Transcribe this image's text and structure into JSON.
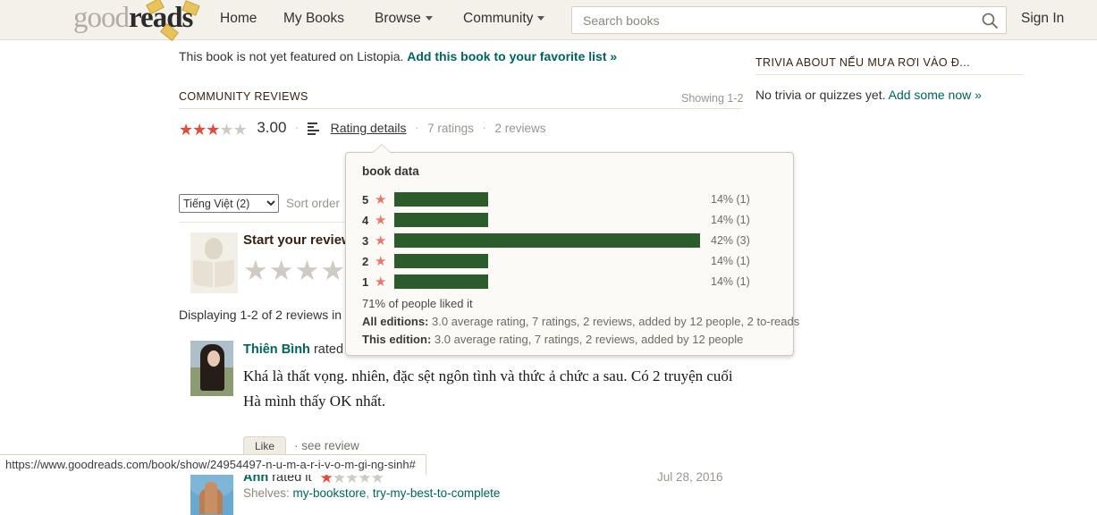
{
  "header": {
    "logo_good": "good",
    "logo_reads": "reads",
    "nav": [
      {
        "label": "Home"
      },
      {
        "label": "My Books"
      },
      {
        "label": "Browse"
      },
      {
        "label": "Community"
      }
    ],
    "search_placeholder": "Search books",
    "search_value": "",
    "search_icon": "search-icon",
    "sign_in": "Sign In"
  },
  "main": {
    "listopia_text": "This book is not yet featured on Listopia.",
    "listopia_link": "Add this book to your favorite list »",
    "community_reviews_heading": "COMMUNITY REVIEWS",
    "showing": "Showing 1-2",
    "rating": {
      "average": "3.00",
      "filled_stars": 3,
      "total_stars": 5,
      "rating_details_label": "Rating details",
      "rating_details_icon": "bar-chart-icon",
      "ratings_count": "7 ratings",
      "reviews_count": "2 reviews",
      "separator": "·"
    },
    "language_filter": {
      "selected": "Tiếng Việt (2)",
      "options": [
        "Tiếng Việt (2)"
      ]
    },
    "sort_order_label": "Sort order",
    "start_your_review": {
      "title": "Start your review",
      "stars": 5,
      "avatar_icon": "default-reader-avatar"
    },
    "displaying_text": "Displaying 1-2 of 2 reviews in",
    "reviews": [
      {
        "name": "Thiên Bình",
        "action": "rated it",
        "body": "Khá là thất vọng. nhiên, đặc sệt ngôn tình và thức ả chức a sau. Có 2 truyện cuối Hà mình thấy OK nhất.",
        "like_label": "Like",
        "see_review_label": "· see review",
        "avatar_icon": "user-photo-avatar"
      },
      {
        "name": "Anh",
        "action": "rated it",
        "filled_stars": 1,
        "total_stars": 5,
        "date": "Jul 28, 2016",
        "shelves_label": "Shelves:",
        "shelves": [
          "my-bookstore",
          "try-my-best-to-complete"
        ],
        "avatar_icon": "user-photo-avatar"
      }
    ]
  },
  "sidebar": {
    "trivia_heading": "TRIVIA ABOUT NẾU MƯA RƠI VÀO Đ...",
    "trivia_empty": "No trivia or quizzes yet.",
    "trivia_link": "Add some now »"
  },
  "tooltip": {
    "title": "book data",
    "liked_text": "71% of people liked it",
    "all_editions_label": "All editions:",
    "all_editions_text": "3.0 average rating, 7 ratings, 2 reviews, added by 12 people, 2 to-reads",
    "this_edition_label": "This edition:",
    "this_edition_text": "3.0 average rating, 7 ratings, 2 reviews, added by 12 people"
  },
  "status_bar": {
    "url": "https://www.goodreads.com/book/show/24954497-n-u-m-a-r-i-v-o-m-gi-ng-sinh#"
  },
  "colors": {
    "header_bg": "#f4f1ea",
    "link_green": "#00635d",
    "star_red": "#e04c3e",
    "bar_green": "#2c5c2c",
    "tooltip_bg": "#fbfaf7"
  },
  "chart_data": {
    "type": "bar",
    "title": "book data",
    "orientation": "horizontal",
    "categories": [
      "5 star",
      "4 star",
      "3 star",
      "2 star",
      "1 star"
    ],
    "values": [
      14,
      14,
      42,
      14,
      14
    ],
    "counts": [
      1,
      1,
      3,
      1,
      1
    ],
    "labels": [
      "14% (1)",
      "14% (1)",
      "42% (3)",
      "14% (1)",
      "14% (1)"
    ],
    "xlabel": "",
    "ylabel": "",
    "xlim": [
      0,
      100
    ],
    "grid": false,
    "legend": "none",
    "bar_color": "#2c5c2c"
  }
}
